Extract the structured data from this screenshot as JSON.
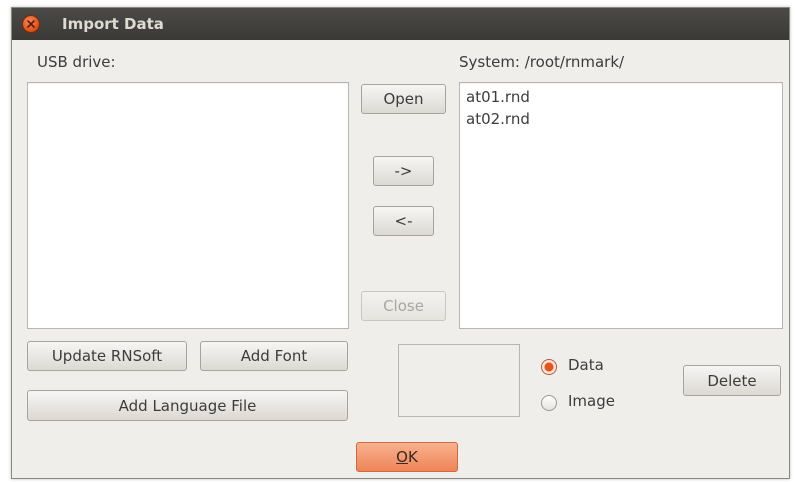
{
  "window": {
    "title": "Import Data"
  },
  "usb": {
    "label": "USB drive:",
    "items": []
  },
  "system": {
    "label": "System: /root/rnmark/",
    "items": [
      "at01.rnd",
      "at02.rnd"
    ]
  },
  "buttons": {
    "open": "Open",
    "copy_right": "->",
    "copy_left": "<-",
    "close": "Close",
    "update_rnsoft": "Update RNSoft",
    "add_font": "Add Font",
    "add_language_file": "Add Language File",
    "delete": "Delete",
    "ok_mnemonic": "O",
    "ok_rest": "K"
  },
  "type_options": {
    "data": "Data",
    "image": "Image",
    "selected": "Data"
  },
  "colors": {
    "accent": "#e6551d",
    "titlebar": "#3c3b37"
  }
}
